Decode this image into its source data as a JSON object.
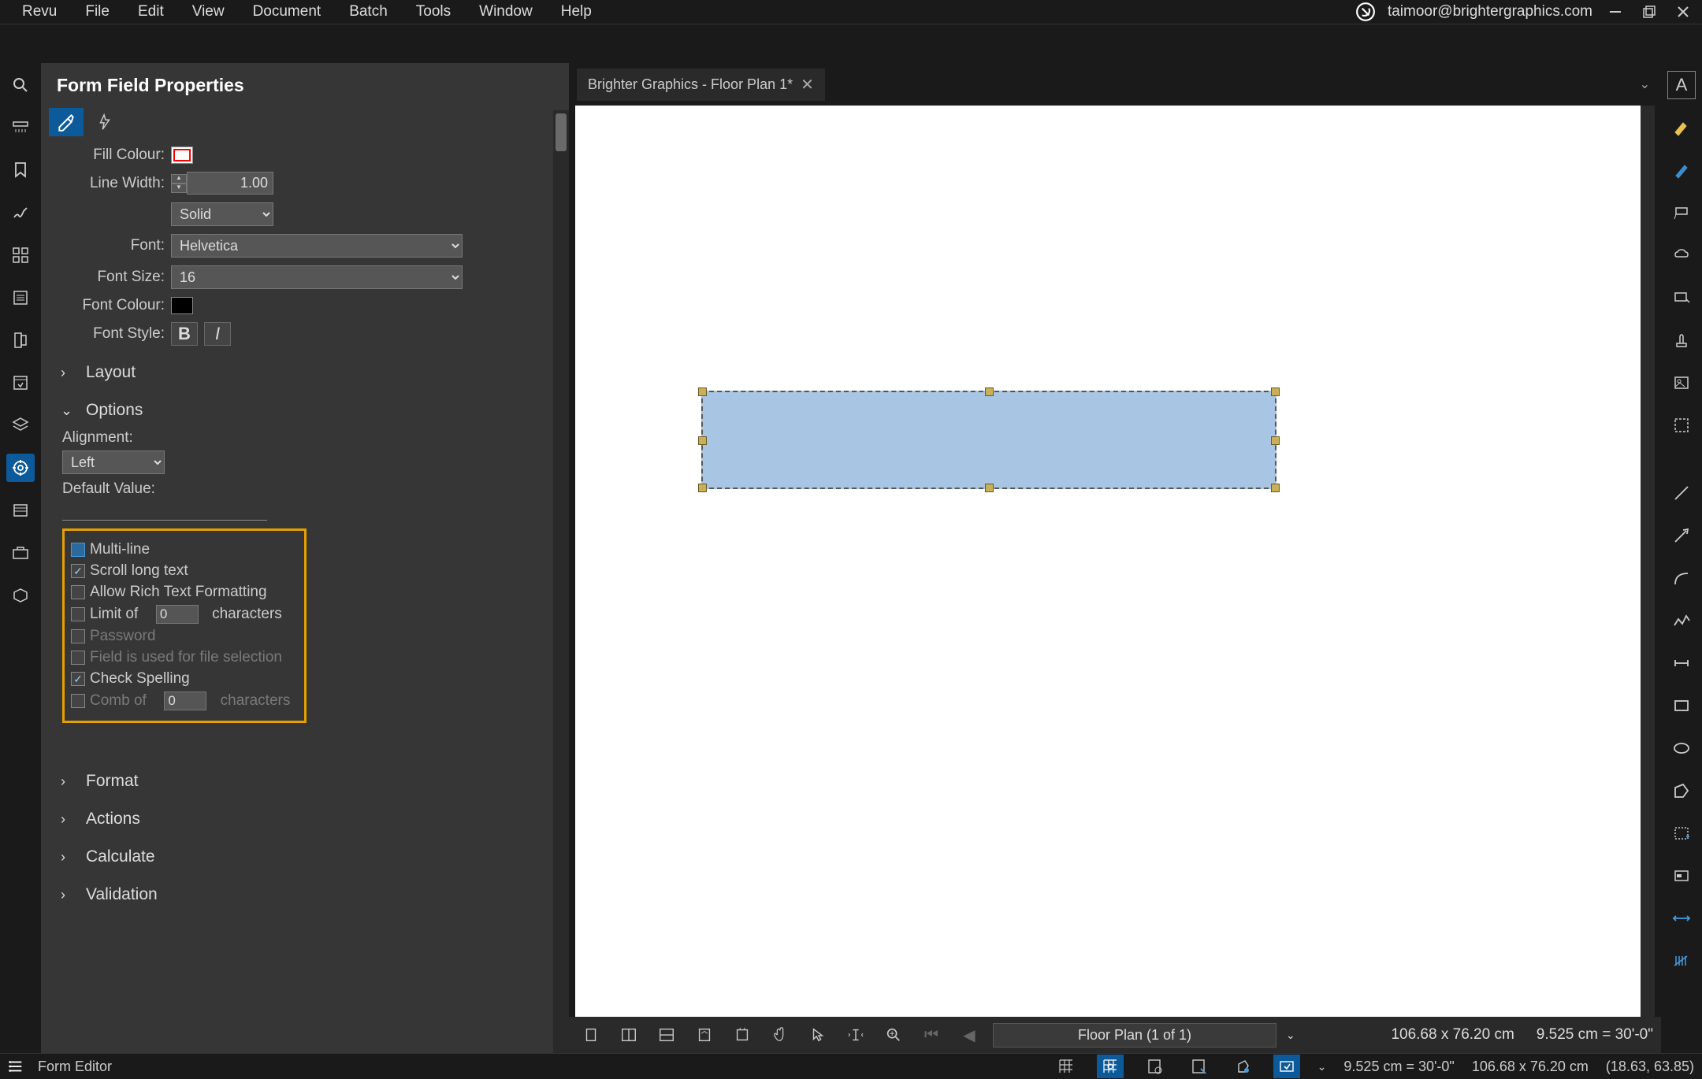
{
  "menubar": {
    "items": [
      "Revu",
      "File",
      "Edit",
      "View",
      "Document",
      "Batch",
      "Tools",
      "Window",
      "Help"
    ],
    "email": "taimoor@brightergraphics.com"
  },
  "panel": {
    "title": "Form Field Properties",
    "fill_colour_label": "Fill Colour:",
    "line_width_label": "Line Width:",
    "line_width_value": "1.00",
    "line_style": "Solid",
    "font_label": "Font:",
    "font_value": "Helvetica",
    "font_size_label": "Font Size:",
    "font_size_value": "16",
    "font_colour_label": "Font Colour:",
    "font_style_label": "Font Style:",
    "sections": {
      "layout": "Layout",
      "options": "Options",
      "format": "Format",
      "actions": "Actions",
      "calculate": "Calculate",
      "validation": "Validation"
    },
    "options": {
      "alignment_label": "Alignment:",
      "alignment_value": "Left",
      "default_value_label": "Default Value:",
      "multi_line": "Multi-line",
      "scroll_long_text": "Scroll long text",
      "allow_rich_text": "Allow Rich Text Formatting",
      "limit_of": "Limit of",
      "limit_value": "0",
      "characters": "characters",
      "password": "Password",
      "file_selection": "Field is used for file selection",
      "check_spelling": "Check Spelling",
      "comb_of": "Comb of",
      "comb_value": "0"
    }
  },
  "document": {
    "tab_title": "Brighter Graphics - Floor Plan 1*",
    "page_indicator": "Floor Plan (1 of 1)"
  },
  "bottom_bar": {
    "dim1": "106.68 x 76.20 cm",
    "dim2": "9.525 cm = 30'-0\""
  },
  "statusbar": {
    "mode": "Form Editor",
    "dim_a": "9.525 cm = 30'-0\"",
    "dim_b": "106.68 x 76.20 cm",
    "coords": "(18.63, 63.85)"
  }
}
